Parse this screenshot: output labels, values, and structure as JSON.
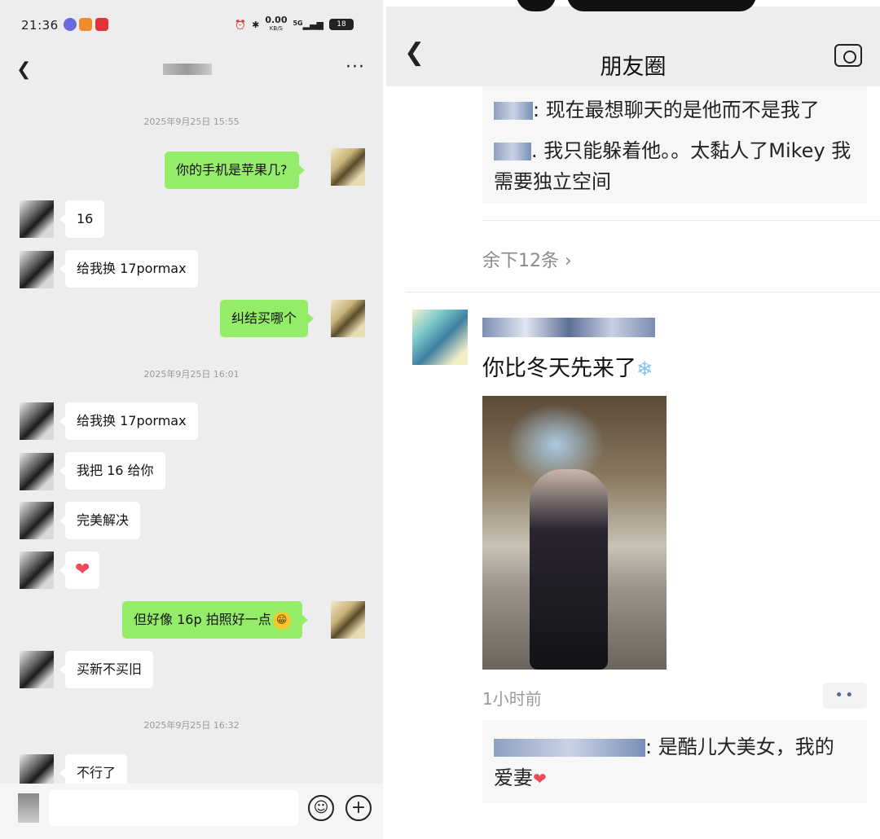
{
  "chat": {
    "status": {
      "time": "21:36",
      "speed": "0.00",
      "speed_unit": "KB/S",
      "network": "5G",
      "battery": "18"
    },
    "timestamps": [
      "2025年9月25日 15:55",
      "2025年9月25日 16:01",
      "2025年9月25日 16:32"
    ],
    "messages": [
      "你的手机是苹果几?",
      "16",
      "给我换 17pormax",
      "纠结买哪个",
      "给我换 17pormax",
      "我把 16 给你",
      "完美解决",
      "❤",
      "但好像 16p 拍照好一点",
      "买新不买旧",
      "不行了"
    ],
    "grin_emoji": "😁",
    "more_icon": "···"
  },
  "moments": {
    "title": "朋友圈",
    "comment_1": ": 现在最想聊天的是他而不是我了",
    "comment_2_line1": ". 我只能躲着他。。太黏人了Mikey 我",
    "comment_2_line2": "需要独立空间",
    "more_comments": "余下12条 ›",
    "post_text": "你比冬天先来了",
    "snowflake": "❄",
    "post_time": "1小时前",
    "post_more": "••",
    "comment_3_line1": ": 是酷儿大美女，我的",
    "comment_3_line2": "爱妻",
    "heart": "❤"
  }
}
